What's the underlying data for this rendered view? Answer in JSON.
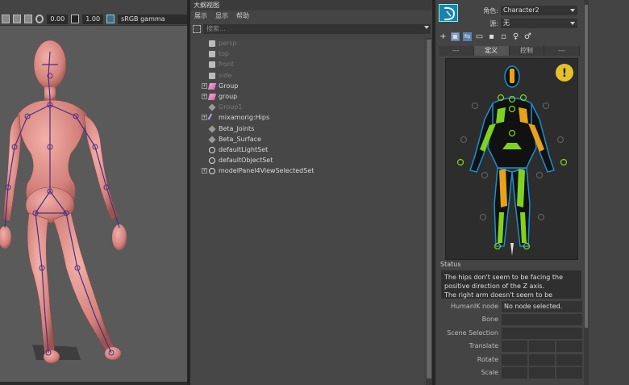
{
  "viewport": {
    "exposure": "0.00",
    "gamma": "1.00",
    "color_space": "sRGB gamma"
  },
  "outliner": {
    "title": "大纲视图",
    "menu": [
      "展示",
      "显示",
      "帮助"
    ],
    "search_placeholder": "搜索...",
    "items": [
      {
        "label": "persp",
        "icon": "camera-icon",
        "dim": true,
        "expandable": false
      },
      {
        "label": "top",
        "icon": "camera-icon",
        "dim": true,
        "expandable": false
      },
      {
        "label": "front",
        "icon": "camera-icon",
        "dim": true,
        "expandable": false
      },
      {
        "label": "side",
        "icon": "camera-icon",
        "dim": true,
        "expandable": false
      },
      {
        "label": "Group",
        "icon": "mesh-group-icon",
        "dim": false,
        "expandable": true
      },
      {
        "label": "group",
        "icon": "mesh-group-icon",
        "dim": false,
        "expandable": true
      },
      {
        "label": "Group1",
        "icon": "transform-icon",
        "dim": true,
        "expandable": false
      },
      {
        "label": "mixamorig:Hips",
        "icon": "joint-icon",
        "dim": false,
        "expandable": true
      },
      {
        "label": "Beta_Joints",
        "icon": "transform-icon",
        "dim": false,
        "expandable": false
      },
      {
        "label": "Beta_Surface",
        "icon": "transform-icon",
        "dim": false,
        "expandable": false
      },
      {
        "label": "defaultLightSet",
        "icon": "set-icon",
        "dim": false,
        "expandable": false
      },
      {
        "label": "defaultObjectSet",
        "icon": "set-icon",
        "dim": false,
        "expandable": false
      },
      {
        "label": "modelPanel4ViewSelectedSet",
        "icon": "set-icon",
        "dim": false,
        "expandable": true
      }
    ]
  },
  "hik": {
    "character_label": "角色:",
    "character_value": "Character2",
    "source_label": "源:",
    "source_value": "无",
    "tabs": [
      "---",
      "定义",
      "控制",
      "---"
    ],
    "active_tab": 1,
    "warning": "!",
    "status_label": "Status",
    "status_lines": [
      "The hips don't seem to be facing the",
      "positive direction of the Z axis.",
      "The right arm doesn't seem to be parallel"
    ],
    "form": {
      "humanik_node_label": "HumanIK node",
      "humanik_node_value": "No node selected.",
      "bone_label": "Bone",
      "scene_selection_label": "Scene Selection",
      "translate_label": "Translate",
      "rotate_label": "Rotate",
      "scale_label": "Scale"
    }
  },
  "colors": {
    "accent": "#1f7fb0",
    "bone_yellow": "#e7a21a",
    "bone_green": "#7ed321",
    "silhouette_outline": "#1a8fd0"
  }
}
